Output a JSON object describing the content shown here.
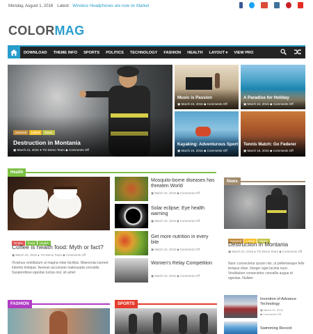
{
  "topbar": {
    "date": "Monday, August 1, 2016",
    "latest_label": "Latest:",
    "latest_news": "Wireless Headphones are now on Market"
  },
  "social_icons": [
    "facebook-icon",
    "twitter-icon",
    "google-plus-icon",
    "instagram-icon",
    "pinterest-icon",
    "youtube-icon"
  ],
  "logo": {
    "part1": "COLOR",
    "part2": "MAG"
  },
  "nav": {
    "items": [
      "DOWNLOAD",
      "THEME INFO",
      "SPORTS",
      "POLITICS",
      "TECHNOLOGY",
      "FASHION",
      "HEALTH",
      "LAYOUT ▾",
      "VIEW PRO"
    ]
  },
  "colors": {
    "accent": "#289dcc",
    "nav_bg": "#232323",
    "health": "#7dc143",
    "news": "#a08c6e",
    "fashion": "#b03cc4",
    "sports": "#e53b2c",
    "general": "#c08c3c",
    "latest": "#f6c22f"
  },
  "featured": {
    "main": {
      "title": "Destruction in Montania",
      "date": "March 24, 2015",
      "author": "TG-Demo Team",
      "comments": "Comments Off",
      "tags": [
        "General",
        "Latest",
        "News"
      ]
    },
    "grid": [
      {
        "title": "Music is Passion",
        "date": "March 24, 2015",
        "comments": "Comments Off"
      },
      {
        "title": "A Paradise for Holiday",
        "date": "March 24, 2015",
        "comments": "Comments Off"
      },
      {
        "title": "Kayaking: Adventurous Sport",
        "date": "March 24, 2015",
        "comments": "Comments Off"
      },
      {
        "title": "Tennis Match: Go Federer",
        "date": "March 19, 2015",
        "comments": "Comments Off"
      }
    ]
  },
  "health": {
    "label": "Health",
    "main": {
      "title": "Coffee is health food: Myth or fact?",
      "date": "March 24, 2015",
      "author": "TG-Demo Team",
      "comments": "Comments Off",
      "tags": [
        "Drinks",
        "Food",
        "Health"
      ],
      "excerpt": "Vivamus vestibulum ut magna vitae facilisis. Maecenas laoreet lobortis tristique. Aenean accumsan malesuada convallis. Suspendisse egestas luctus nisl, sit amet"
    },
    "list": [
      {
        "title": "Mosquito-borne diseases has threaten World",
        "date": "March 24, 2015",
        "comments": "Comments Off"
      },
      {
        "title": "Solar eclipse: Eye health warning",
        "date": "March 24, 2015",
        "comments": "Comments Off"
      },
      {
        "title": "Get more nutrition in every bite",
        "date": "March 24, 2015",
        "comments": "Comments Off"
      },
      {
        "title": "Women's Relay Competition",
        "date": "March 24, 2015",
        "comments": "Comments Off"
      }
    ]
  },
  "news": {
    "label": "News",
    "main": {
      "title": "Destruction in Montania",
      "date": "March 24, 2015",
      "author": "TG-Demo Team",
      "comments": "Comments Off",
      "tags": [
        "General",
        "Latest",
        "News"
      ],
      "excerpt": "Nunc consectetur ipsum nisi, ut pellentesque felis tempus vitae. Integer eget lacinia nunc. Vestibulum consectetur convallis augue id egestas. Nullam"
    },
    "list": [
      {
        "title": "Invention of Advance Technology",
        "date": "March 24, 2015",
        "comments": "Comments Off"
      },
      {
        "title": "Swimming Record",
        "date": "",
        "comments": ""
      }
    ]
  },
  "fashion": {
    "label": "FASHION"
  },
  "sports": {
    "label": "SPORTS"
  }
}
